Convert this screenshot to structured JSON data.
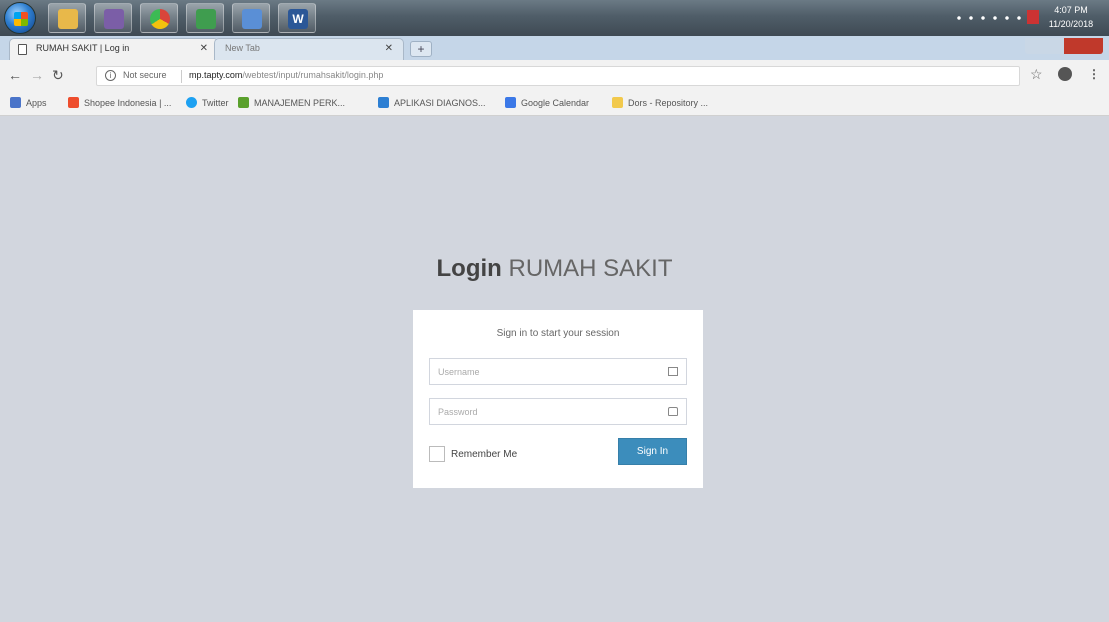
{
  "taskbar": {
    "apps": [
      {
        "name": "explorer",
        "color": "#e8b84a"
      },
      {
        "name": "visual-studio",
        "color": "#7b5ea7"
      },
      {
        "name": "chrome",
        "color": "#d9453a"
      },
      {
        "name": "photo-app",
        "color": "#3f9d4f"
      },
      {
        "name": "media-app",
        "color": "#5a8fd6"
      },
      {
        "name": "word",
        "color": "#2b5797"
      }
    ],
    "clock_time": "4:07 PM",
    "clock_date": "11/20/2018"
  },
  "browser": {
    "tabs": [
      {
        "title": "RUMAH SAKIT | Log in"
      },
      {
        "title": "New Tab"
      }
    ],
    "address": {
      "security_label": "Not secure",
      "url_host": "mp.tapty.com",
      "url_path": "/webtest/input/rumahsakit/login.php"
    },
    "bookmarks": [
      {
        "label": "Apps",
        "color": "#4a74c9"
      },
      {
        "label": "Shopee Indonesia | ...",
        "color": "#ee4d2d"
      },
      {
        "label": "Twitter",
        "color": "#1da1f2"
      },
      {
        "label": "MANAJEMEN PERK...",
        "color": "#5aa02c"
      },
      {
        "label": "APLIKASI DIAGNOS...",
        "color": "#2d7fd3"
      },
      {
        "label": "Google Calendar",
        "color": "#3b78e7"
      },
      {
        "label": "Dors - Repository ...",
        "color": "#f2c94c"
      }
    ]
  },
  "login": {
    "title_bold": "Login",
    "title_light": "RUMAH SAKIT",
    "message": "Sign in to start your session",
    "username_placeholder": "Username",
    "password_placeholder": "Password",
    "remember_label": "Remember Me",
    "signin_label": "Sign In"
  }
}
